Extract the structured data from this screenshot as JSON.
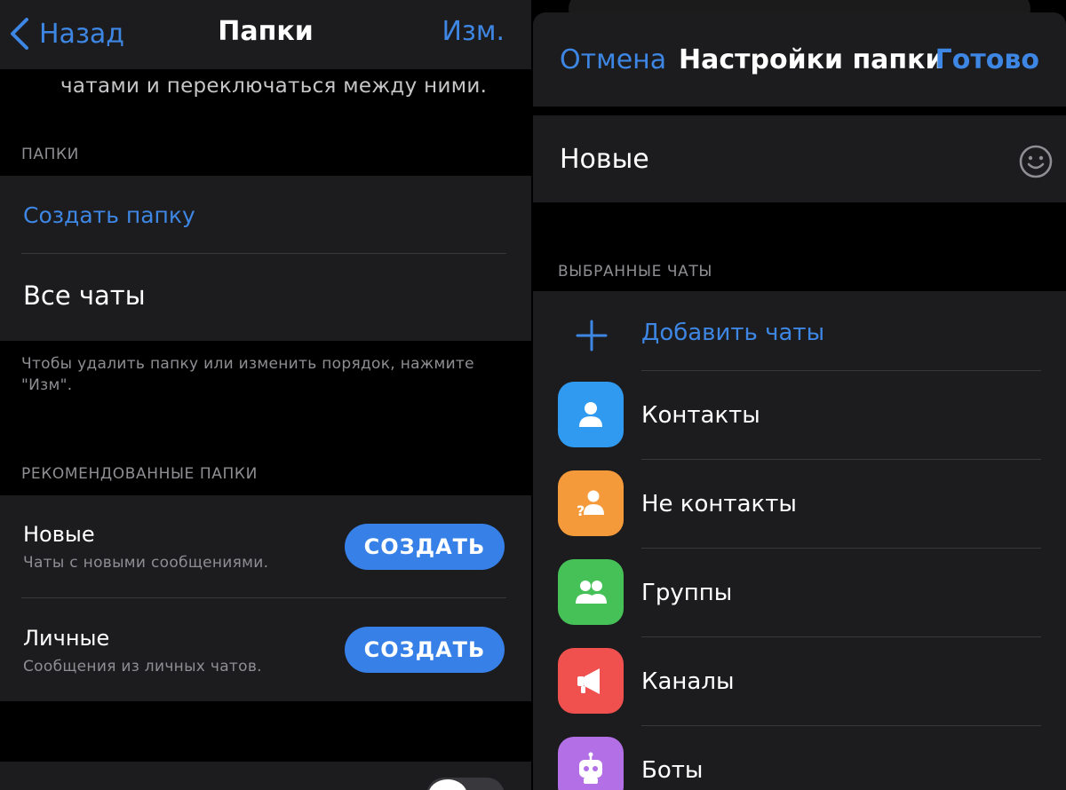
{
  "left": {
    "nav": {
      "back_label": "Назад",
      "title": "Папки",
      "edit_label": "Изм."
    },
    "intro_text": "чатами и переключаться между ними.",
    "folders_section": {
      "header": "ПАПКИ",
      "create_folder_label": "Создать папку",
      "all_chats_label": "Все чаты",
      "footnote": "Чтобы удалить папку или изменить порядок, нажмите \"Изм\"."
    },
    "recommended_section": {
      "header": "РЕКОМЕНДОВАННЫЕ ПАПКИ",
      "items": [
        {
          "title": "Новые",
          "subtitle": "Чаты с новыми сообщениями.",
          "button_label": "СОЗДАТЬ"
        },
        {
          "title": "Личные",
          "subtitle": "Сообщения из личных чатов.",
          "button_label": "СОЗДАТЬ"
        }
      ]
    },
    "toggle": {
      "on": false
    }
  },
  "right": {
    "nav": {
      "cancel_label": "Отмена",
      "title": "Настройки папки",
      "done_label": "Готово"
    },
    "folder_name": "Новые",
    "selected_section": {
      "header": "ВЫБРАННЫЕ ЧАТЫ",
      "add_label": "Добавить чаты",
      "items": [
        {
          "label": "Контакты",
          "icon": "contact-icon",
          "color": "#2f9af0"
        },
        {
          "label": "Не контакты",
          "icon": "non-contact-icon",
          "color": "#f59a3a"
        },
        {
          "label": "Группы",
          "icon": "group-icon",
          "color": "#45c157"
        },
        {
          "label": "Каналы",
          "icon": "megaphone-icon",
          "color": "#f0504e"
        },
        {
          "label": "Боты",
          "icon": "bot-icon",
          "color": "#b26fe6"
        }
      ]
    }
  },
  "colors": {
    "accent": "#3e86e3",
    "button": "#3780e8",
    "cell": "#1c1c1e",
    "background": "#000000"
  }
}
